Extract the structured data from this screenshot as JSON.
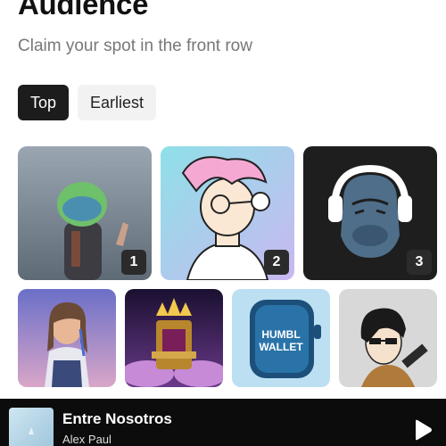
{
  "header": {
    "title": "Audience",
    "subtitle": "Claim your spot in the front row"
  },
  "tabs": [
    {
      "label": "Top",
      "active": true
    },
    {
      "label": "Earliest",
      "active": false
    }
  ],
  "top_members": [
    {
      "rank": "1",
      "avatar": "robot-helmet-avatar"
    },
    {
      "rank": "2",
      "avatar": "pink-hair-cartoon-avatar"
    },
    {
      "rank": "3",
      "avatar": "ape-headphones-avatar"
    }
  ],
  "members": [
    {
      "avatar": "3d-girl-avatar"
    },
    {
      "avatar": "golden-throne-avatar"
    },
    {
      "avatar": "humbl-wallet-watch-avatar",
      "text": "HUMBL WALLET"
    },
    {
      "avatar": "sunglasses-cartoon-avatar"
    }
  ],
  "player": {
    "track": "Entre Nosotros",
    "artist": "Alex Paul",
    "play_icon": "play-icon"
  },
  "colors": {
    "active_tab_bg": "#1c1c1c",
    "inactive_tab_bg": "#f2f2f2",
    "player_bg": "#0c0c0c"
  }
}
